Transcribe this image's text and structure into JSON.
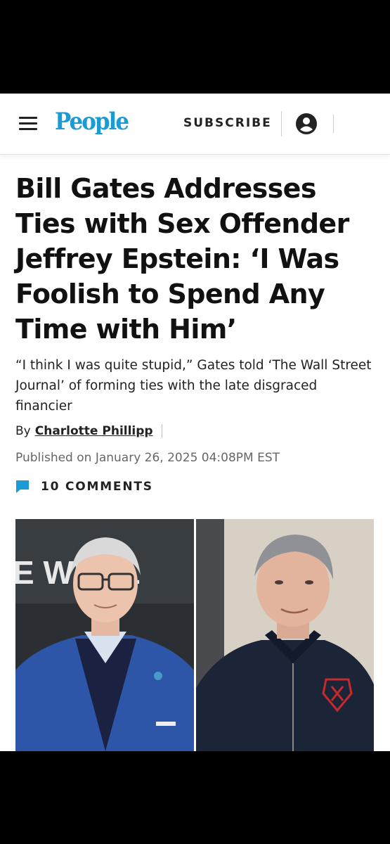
{
  "header": {
    "logo": "People",
    "subscribe_label": "SUBSCRIBE",
    "menu_icon": "hamburger-menu-icon",
    "account_icon": "user-account-icon"
  },
  "article": {
    "headline": "Bill Gates Addresses Ties with Sex Offender Jeffrey Epstein: ‘I Was Foolish to Spend Any Time with Him’",
    "dek": "“I think I was quite stupid,” Gates told ‘The Wall Street Journal’ of forming ties with the late disgraced financier",
    "byline_prefix": "By",
    "author": "Charlotte Phillipp",
    "published": "Published on January 26, 2025 04:08PM EST",
    "comments_label": "10 COMMENTS",
    "comment_icon": "speech-bubble-icon"
  },
  "hero_image": {
    "left_panel_text": "E WI      ILL"
  },
  "colors": {
    "brand_blue": "#1c9ad6",
    "text": "#111111",
    "muted": "#666666"
  }
}
